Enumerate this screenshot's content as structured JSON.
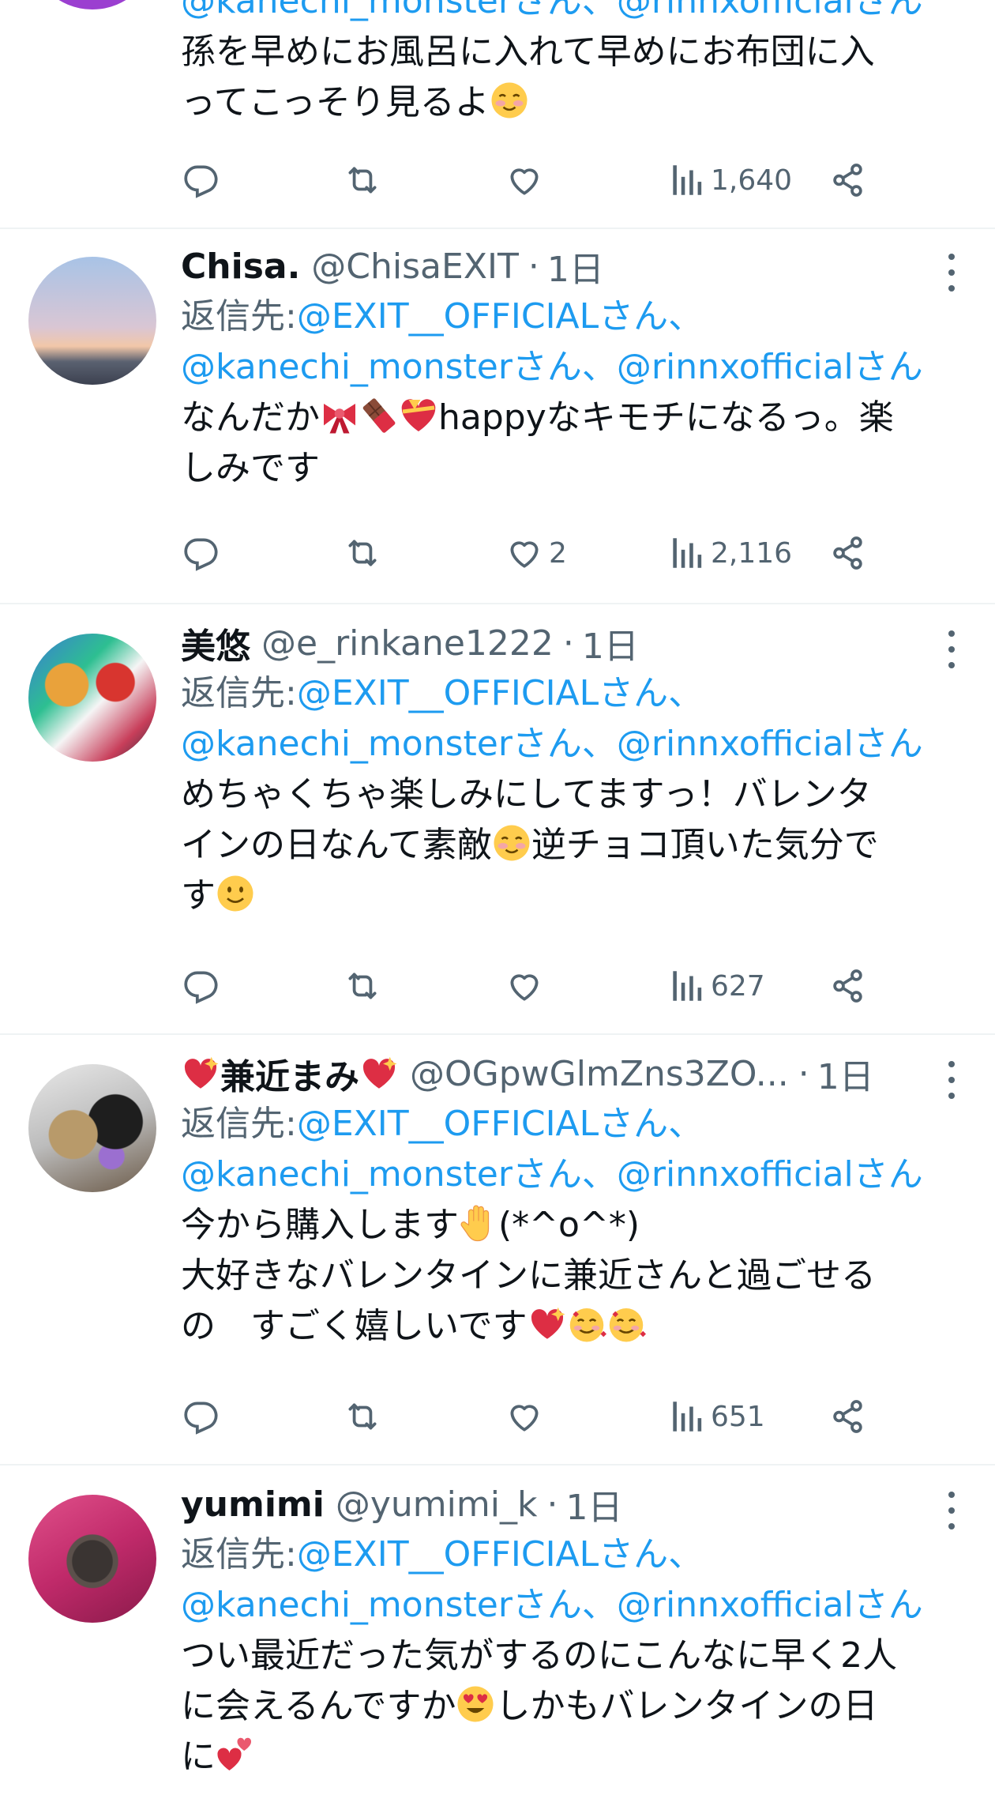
{
  "reply_label": "返信先:",
  "mention1": "@EXIT__OFFICIALさん、",
  "mention2": "@kanechi_monsterさん、@rinnxofficialさん",
  "tweet0": {
    "mentions_partial": "@kanechi_monsterさん、@rinnxofficialさん",
    "text_line1": "孫を早めにお風呂に入れて早めにお布団に入",
    "text_line2": "ってこっそり見るよ",
    "emoji": "smiling-blush-emoji",
    "likes": "",
    "views": "1,640"
  },
  "tweet1": {
    "name": "Chisa.",
    "handle": "@ChisaEXIT",
    "sep": "·",
    "time": "1日",
    "text_line1a": "なんだか",
    "text_line1b": "happyなキモチになるっ。楽",
    "text_line2": "しみです",
    "likes": "2",
    "views": "2,116"
  },
  "tweet2": {
    "name": "美悠",
    "handle": "@e_rinkane1222",
    "sep": "·",
    "time": "1日",
    "text_line1": "めちゃくちゃ楽しみにしてますっ！バレンタ",
    "text_line2a": "インの日なんて素敵",
    "text_line2b": "逆チョコ頂いた気分で",
    "text_line3": "す",
    "likes": "",
    "views": "627"
  },
  "tweet3": {
    "name": "兼近まみ",
    "handle": "@OGpwGlmZns3ZO...",
    "sep": "·",
    "time": "1日",
    "text_line1a": "今から購入します",
    "text_line1b": "(*^o^*)",
    "text_line2": "大好きなバレンタインに兼近さんと過ごせる",
    "text_line3": "の　すごく嬉しいです",
    "likes": "",
    "views": "651"
  },
  "tweet4": {
    "name": "yumimi",
    "handle": "@yumimi_k",
    "sep": "·",
    "time": "1日",
    "text_line1": "つい最近だった気がするのにこんなに早く2人",
    "text_line2a": "に会えるんですか",
    "text_line2b": "しかもバレンタインの日",
    "text_line3": "に"
  },
  "colors": {
    "mention": "#1d9bf0",
    "secondary": "#536471",
    "divider": "#eff3f4"
  }
}
